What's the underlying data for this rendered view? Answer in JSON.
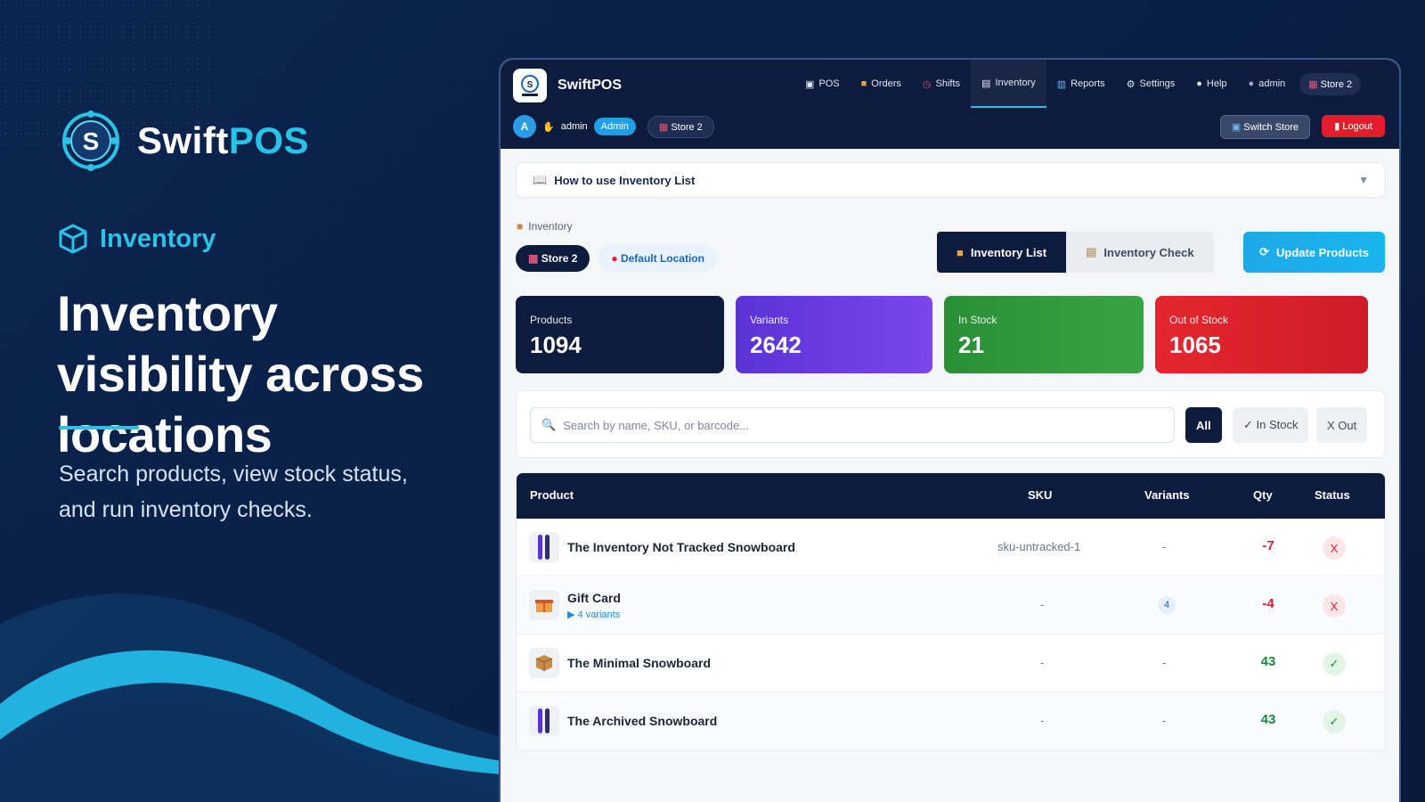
{
  "brand": {
    "name_part1": "Swift",
    "name_part2": "POS",
    "icon": "swiftpos-logo"
  },
  "hero": {
    "tag": "Inventory",
    "tag_icon": "cube-icon",
    "headline": "Inventory visibility across locations",
    "subtext": "Search products, view stock status, and run inventory checks."
  },
  "app": {
    "title": "SwiftPOS",
    "nav": [
      {
        "label": "POS",
        "icon": "register-icon"
      },
      {
        "label": "Orders",
        "icon": "box-icon"
      },
      {
        "label": "Shifts",
        "icon": "clock-icon"
      },
      {
        "label": "Inventory",
        "icon": "clipboard-icon",
        "active": true
      },
      {
        "label": "Reports",
        "icon": "chart-icon"
      },
      {
        "label": "Settings",
        "icon": "gear-icon"
      },
      {
        "label": "Help",
        "icon": "chat-icon"
      },
      {
        "label": "admin",
        "icon": "user-icon"
      }
    ],
    "nav_store": "Store 2",
    "user": {
      "initial": "A",
      "name": "admin",
      "role": "Admin",
      "store": "Store 2"
    },
    "switch_store": "Switch Store",
    "logout": "Logout",
    "help_title": "How to use Inventory List",
    "breadcrumb": "Inventory",
    "location_store": "Store 2",
    "location_default": "Default Location",
    "tab_list": "Inventory List",
    "tab_check": "Inventory Check",
    "update_products": "Update Products",
    "stats": [
      {
        "label": "Products",
        "value": "1094",
        "color": "#0d1b3d"
      },
      {
        "label": "Variants",
        "value": "2642",
        "color": "#6a3be3"
      },
      {
        "label": "In Stock",
        "value": "21",
        "color": "#2e9a3c"
      },
      {
        "label": "Out of Stock",
        "value": "1065",
        "color": "#e2252f"
      }
    ],
    "search_placeholder": "Search by name, SKU, or barcode...",
    "filters": {
      "all": "All",
      "in_stock": "✓ In Stock",
      "out": "X Out"
    },
    "table": {
      "headers": {
        "product": "Product",
        "sku": "SKU",
        "variants": "Variants",
        "qty": "Qty",
        "status": "Status"
      },
      "rows": [
        {
          "name": "The Inventory Not Tracked Snowboard",
          "sku": "sku-untracked-1",
          "variants": "-",
          "qty": "-7",
          "status": "X",
          "in_stock": false,
          "thumb": "snowboard-icon"
        },
        {
          "name": "Gift Card",
          "sub": "▶ 4 variants",
          "sku": "-",
          "variants": "4",
          "qty": "-4",
          "status": "X",
          "in_stock": false,
          "thumb": "gift-icon"
        },
        {
          "name": "The Minimal Snowboard",
          "sku": "-",
          "variants": "-",
          "qty": "43",
          "status": "✓",
          "in_stock": true,
          "thumb": "package-icon"
        },
        {
          "name": "The Archived Snowboard",
          "sku": "-",
          "variants": "-",
          "qty": "43",
          "status": "✓",
          "in_stock": true,
          "thumb": "snowboard-icon"
        }
      ]
    }
  }
}
